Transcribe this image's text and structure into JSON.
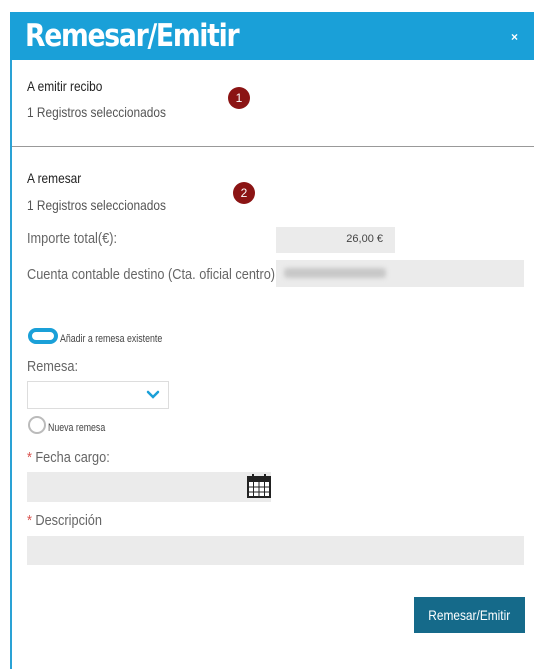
{
  "dialog": {
    "title": "Remesar/Emitir",
    "close_icon": "×"
  },
  "section1": {
    "title": "A emitir recibo",
    "subtitle": "1 Registros seleccionados",
    "badge": "1"
  },
  "section2": {
    "title": "A remesar",
    "subtitle": "1 Registros seleccionados",
    "badge": "2",
    "importe_label": "Importe total(€):",
    "importe_value": "26,00 €",
    "cuenta_label": "Cuenta contable destino (Cta. oficial centro)"
  },
  "options": {
    "toggle_label": "Añadir a remesa existente",
    "remesa_label": "Remesa:",
    "radio_label": "Nueva remesa",
    "fecha_label": "Fecha cargo:",
    "descripcion_label": "Descripción",
    "required_mark": "*"
  },
  "actions": {
    "submit_label": "Remesar/Emitir"
  },
  "colors": {
    "header": "#1aa0d8",
    "button": "#156a8a",
    "badge": "#8b1414"
  }
}
